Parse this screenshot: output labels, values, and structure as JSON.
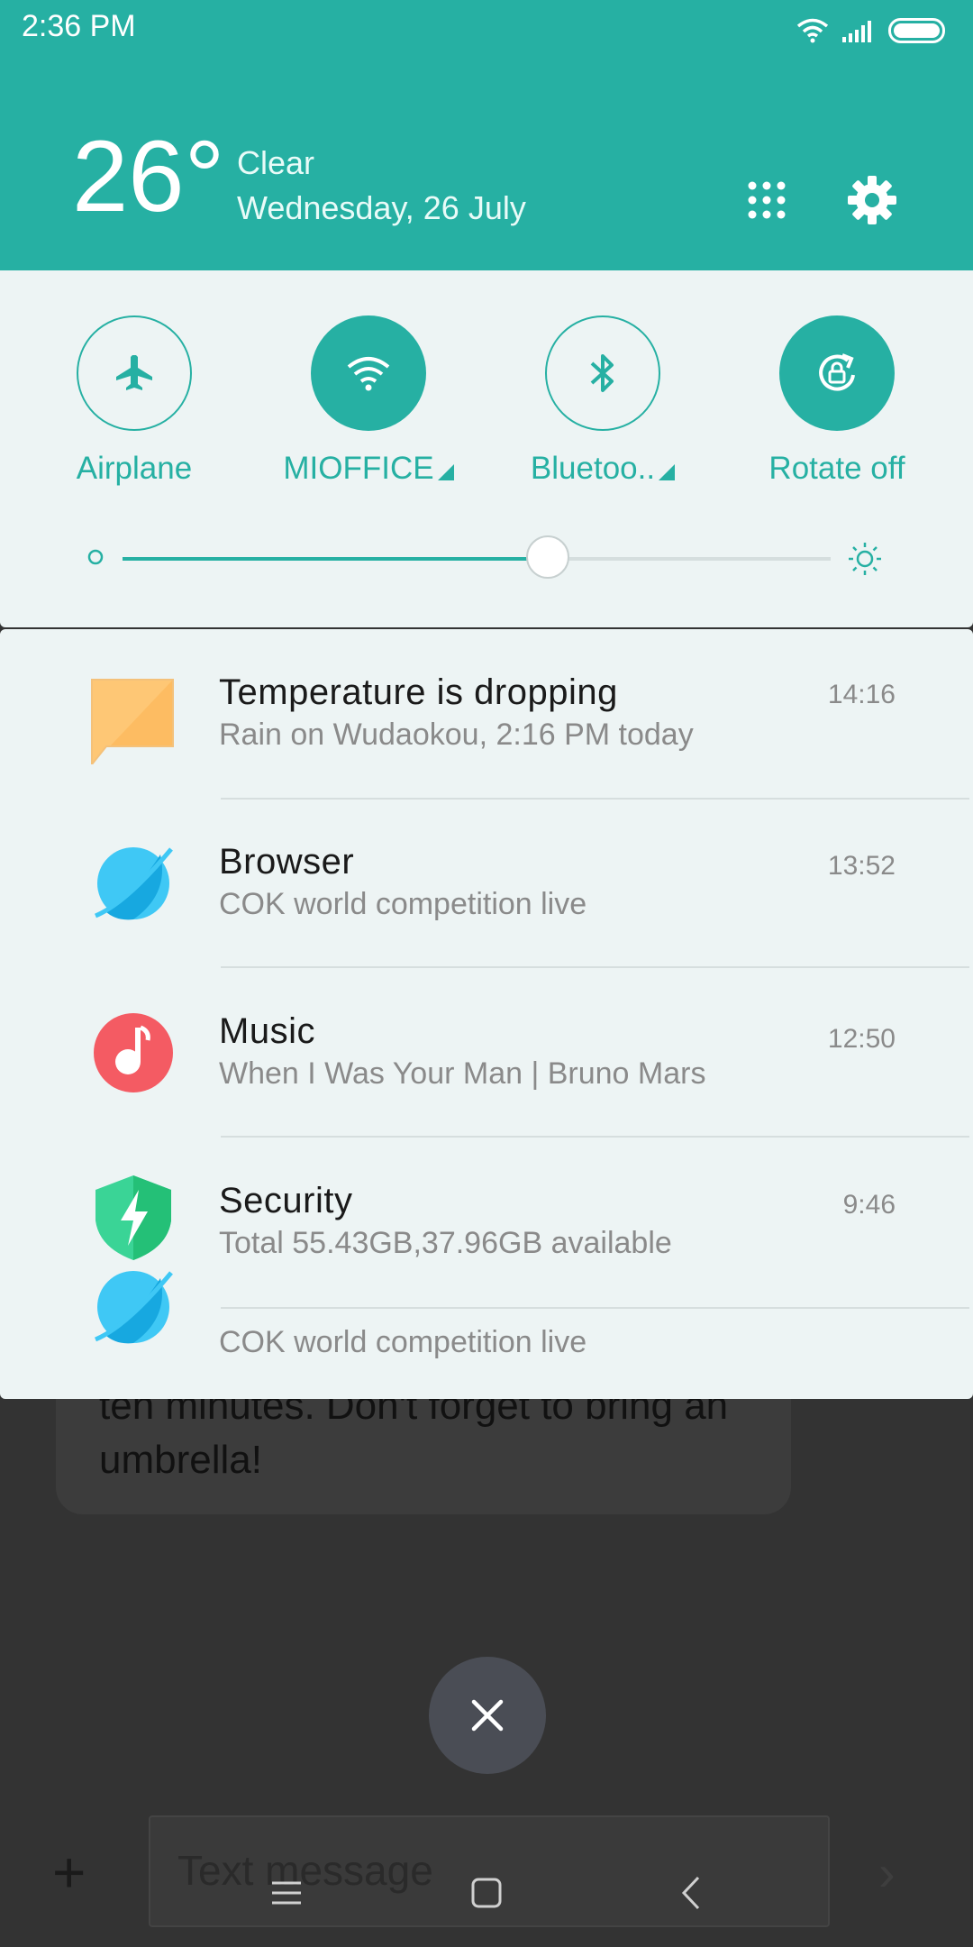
{
  "status_bar": {
    "time": "2:36 PM",
    "icons": [
      "wifi-icon",
      "signal-icon",
      "battery-icon"
    ]
  },
  "weather": {
    "temperature": "26°",
    "condition": "Clear",
    "date": "Wednesday, 26 July"
  },
  "header_actions": [
    "apps-grid-icon",
    "settings-gear-icon"
  ],
  "quick_settings": {
    "toggles": [
      {
        "label": "Airplane",
        "icon": "airplane-icon",
        "active": false,
        "has_dropdown": false
      },
      {
        "label": "MIOFFICE",
        "icon": "wifi-icon",
        "active": true,
        "has_dropdown": true
      },
      {
        "label": "Bluetoo..",
        "icon": "bluetooth-icon",
        "active": false,
        "has_dropdown": true
      },
      {
        "label": "Rotate off",
        "icon": "rotate-lock-icon",
        "active": true,
        "has_dropdown": false
      }
    ],
    "brightness": 0.6
  },
  "notifications": [
    {
      "title": "Temperature  is  dropping",
      "subtitle": "Rain on Wudaokou, 2:16 PM today",
      "time": "14:16",
      "icon": "message-icon"
    },
    {
      "title": "Browser",
      "subtitle": "COK world competition live",
      "time": "13:52",
      "icon": "browser-icon"
    },
    {
      "title": "Music",
      "subtitle": "When I Was Your Man | Bruno Mars",
      "time": "12:50",
      "icon": "music-icon"
    },
    {
      "title": "Security",
      "subtitle": "Total 55.43GB,37.96GB available",
      "time": "9:46",
      "icon": "security-shield-icon"
    },
    {
      "title": "",
      "subtitle": "COK world competition live",
      "time": "",
      "icon": "browser-icon"
    }
  ],
  "background_app": {
    "message_text": "ten minutes. Don't forget to bring an umbrella!",
    "composer_placeholder": "Text message"
  },
  "colors": {
    "accent": "#26b0a3",
    "panel": "#edf4f4",
    "scrim": "#333333"
  }
}
